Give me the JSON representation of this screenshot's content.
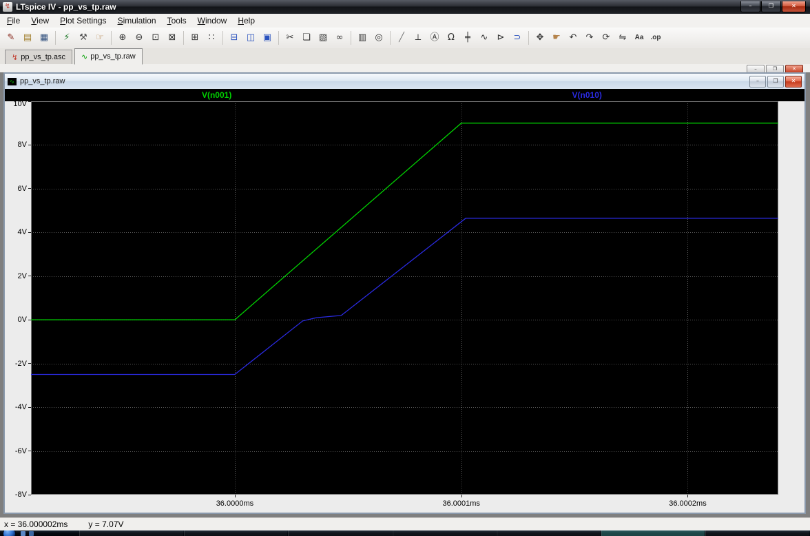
{
  "window": {
    "title": "LTspice IV - pp_vs_tp.raw",
    "icon_glyph": "↯",
    "controls": {
      "minimize": "–",
      "maximize": "❐",
      "close": "✕"
    }
  },
  "menu": {
    "items": [
      "File",
      "View",
      "Plot Settings",
      "Simulation",
      "Tools",
      "Window",
      "Help"
    ]
  },
  "toolbar": {
    "icons": [
      {
        "name": "new-schematic",
        "glyph": "✎",
        "color": "#8a2b20"
      },
      {
        "name": "open",
        "glyph": "▤",
        "color": "#a07d2a"
      },
      {
        "name": "save",
        "glyph": "▦",
        "color": "#31507d"
      },
      {
        "sep": true
      },
      {
        "name": "run",
        "glyph": "⚡",
        "color": "#207a2a"
      },
      {
        "name": "control-panel",
        "glyph": "⚒",
        "color": "#555555"
      },
      {
        "name": "pan",
        "glyph": "☞",
        "color": "#b5834a"
      },
      {
        "sep": true
      },
      {
        "name": "zoom-in",
        "glyph": "⊕",
        "color": "#333333"
      },
      {
        "name": "zoom-out",
        "glyph": "⊖",
        "color": "#333333"
      },
      {
        "name": "zoom-area",
        "glyph": "⊡",
        "color": "#333333"
      },
      {
        "name": "zoom-full-extents",
        "glyph": "⊠",
        "color": "#333333"
      },
      {
        "sep": true
      },
      {
        "name": "grid",
        "glyph": "⊞",
        "color": "#333333"
      },
      {
        "name": "mark-data-points",
        "glyph": "∷",
        "color": "#333333"
      },
      {
        "sep": true
      },
      {
        "name": "tile-horizontally",
        "glyph": "⊟",
        "color": "#2a52be"
      },
      {
        "name": "tile-vertically",
        "glyph": "◫",
        "color": "#2a52be"
      },
      {
        "name": "cascade-windows",
        "glyph": "▣",
        "color": "#2a52be"
      },
      {
        "sep": true
      },
      {
        "name": "cut",
        "glyph": "✂",
        "color": "#333333"
      },
      {
        "name": "copy",
        "glyph": "❏",
        "color": "#333333"
      },
      {
        "name": "paste",
        "glyph": "▧",
        "color": "#333333"
      },
      {
        "name": "find",
        "glyph": "∞",
        "color": "#333333"
      },
      {
        "sep": true
      },
      {
        "name": "print",
        "glyph": "▥",
        "color": "#333333"
      },
      {
        "name": "print-preview",
        "glyph": "◎",
        "color": "#333333"
      },
      {
        "sep": true
      },
      {
        "name": "wire",
        "glyph": "╱",
        "color": "#777777"
      },
      {
        "name": "ground",
        "glyph": "⟂",
        "color": "#333333"
      },
      {
        "name": "label-net",
        "glyph": "Ⓐ",
        "color": "#333333"
      },
      {
        "name": "resistor",
        "glyph": "Ω",
        "color": "#333333"
      },
      {
        "name": "capacitor",
        "glyph": "╪",
        "color": "#333333"
      },
      {
        "name": "inductor",
        "glyph": "∿",
        "color": "#333333"
      },
      {
        "name": "diode",
        "glyph": "⊳",
        "color": "#333333"
      },
      {
        "name": "component",
        "glyph": "⊃",
        "color": "#2a52be"
      },
      {
        "sep": true
      },
      {
        "name": "move",
        "glyph": "✥",
        "color": "#333333"
      },
      {
        "name": "drag",
        "glyph": "☛",
        "color": "#b5834a"
      },
      {
        "name": "undo",
        "glyph": "↶",
        "color": "#333333"
      },
      {
        "name": "redo",
        "glyph": "↷",
        "color": "#333333"
      },
      {
        "name": "rotate",
        "glyph": "⟳",
        "color": "#333333"
      },
      {
        "name": "mirror",
        "glyph": "⇋",
        "color": "#333333"
      },
      {
        "name": "text",
        "glyph": "Aa",
        "color": "#333333",
        "small": true
      },
      {
        "name": "spice-directive",
        "glyph": ".op",
        "color": "#333333",
        "small": true
      }
    ]
  },
  "tabs": [
    {
      "label": "pp_vs_tp.asc",
      "icon": "schematic-icon",
      "glyph": "↯",
      "glyph_color": "#c0392b",
      "active": false
    },
    {
      "label": "pp_vs_tp.raw",
      "icon": "waveform-icon",
      "glyph": "∿",
      "glyph_color": "#00a000",
      "active": true
    }
  ],
  "mdi_bar": {
    "minimize": "–",
    "restore": "❐",
    "close": "✕"
  },
  "child_window": {
    "title": "pp_vs_tp.raw",
    "icon_glyph": "∿",
    "controls": {
      "minimize": "–",
      "maximize": "❐",
      "close": "✕"
    }
  },
  "status_bar": {
    "x_readout": "x = 36.000002ms",
    "y_readout": "y = 7.07V"
  },
  "taskbar": {
    "button_count": 7,
    "accent_button_index": 5
  },
  "chart_data": {
    "type": "line",
    "title": "",
    "x_unit": "ms",
    "xlim": [
      35.99991,
      36.00024
    ],
    "ylim": [
      -8,
      10
    ],
    "x_ticks": [
      {
        "value": 36.0,
        "label": "36.0000ms"
      },
      {
        "value": 36.0001,
        "label": "36.0001ms"
      },
      {
        "value": 36.0002,
        "label": "36.0002ms"
      }
    ],
    "y_ticks": [
      {
        "value": 10,
        "label": "10V"
      },
      {
        "value": 8,
        "label": "8V"
      },
      {
        "value": 6,
        "label": "6V"
      },
      {
        "value": 4,
        "label": "4V"
      },
      {
        "value": 2,
        "label": "2V"
      },
      {
        "value": 0,
        "label": "0V"
      },
      {
        "value": -2,
        "label": "-2V"
      },
      {
        "value": -4,
        "label": "-4V"
      },
      {
        "value": -6,
        "label": "-6V"
      },
      {
        "value": -8,
        "label": "-8V"
      }
    ],
    "grid": true,
    "background": "#000000",
    "grid_color": "#565656",
    "legend_position": "top",
    "series": [
      {
        "name": "V(n001)",
        "color": "#00d000",
        "legend_x_frac": 0.265,
        "points": [
          [
            35.99991,
            0
          ],
          [
            36.0,
            0
          ],
          [
            36.0001,
            9
          ],
          [
            36.00024,
            9
          ]
        ]
      },
      {
        "name": "V(n010)",
        "color": "#2a2ae0",
        "legend_x_frac": 0.728,
        "points": [
          [
            35.99991,
            -2.5
          ],
          [
            36.0,
            -2.5
          ],
          [
            36.00003,
            -0.05
          ],
          [
            36.000036,
            0.1
          ],
          [
            36.000047,
            0.2
          ],
          [
            36.000102,
            4.65
          ],
          [
            36.00024,
            4.65
          ]
        ]
      }
    ]
  }
}
